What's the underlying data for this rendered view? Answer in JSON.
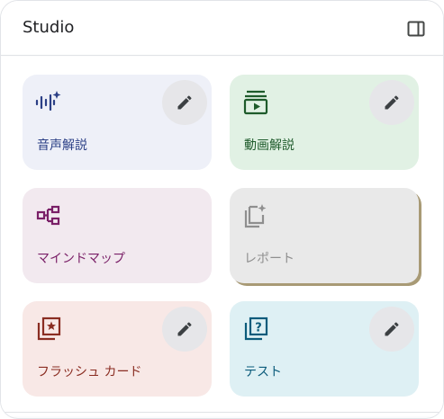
{
  "panel": {
    "title": "Studio",
    "toggle_icon": "side-panel-toggle-icon"
  },
  "cards": [
    {
      "id": "audio-overview",
      "label": "音声解説",
      "icon": "audio-waveform-sparkle-icon",
      "bg": "#eef0f8",
      "fg": "#2b3f86",
      "editable": true
    },
    {
      "id": "video-overview",
      "label": "動画解説",
      "icon": "video-library-icon",
      "bg": "#e1f1e4",
      "fg": "#1e5b2b",
      "editable": true
    },
    {
      "id": "mind-map",
      "label": "マインドマップ",
      "icon": "mind-map-icon",
      "bg": "#f2e9ef",
      "fg": "#7a1f67",
      "editable": false
    },
    {
      "id": "report",
      "label": "レポート",
      "icon": "report-sparkle-icon",
      "bg": "#e9e9e9",
      "fg": "#8f8f8f",
      "editable": false
    },
    {
      "id": "flashcards",
      "label": "フラッシュ カード",
      "icon": "flashcards-star-icon",
      "bg": "#f8e8e6",
      "fg": "#8a2d22",
      "editable": true
    },
    {
      "id": "quiz",
      "label": "テスト",
      "icon": "quiz-question-icon",
      "bg": "#def0f4",
      "fg": "#0b5b7b",
      "editable": true
    }
  ],
  "edit_icon": "pencil-icon"
}
